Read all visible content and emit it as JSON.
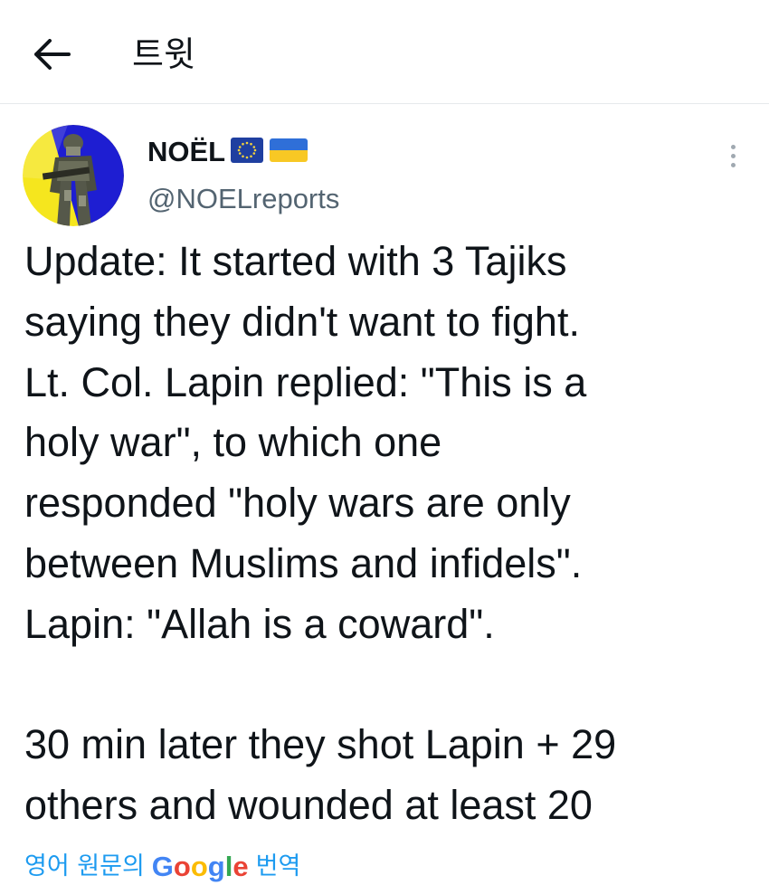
{
  "header": {
    "back_icon": "arrow-left-icon",
    "title": "트윗"
  },
  "author": {
    "display_name": "NOËL",
    "flags": [
      "eu-flag-icon",
      "ukraine-flag-icon"
    ],
    "handle": "@NOELreports",
    "more_icon": "more-vertical-icon"
  },
  "tweet": {
    "text": "Update: It started with 3 Tajiks\nsaying they didn't want to fight.\nLt. Col. Lapin replied: \"This is a\nholy war\", to which one\nresponded \"holy wars are only\nbetween Muslims and infidels\".\nLapin: \"Allah is a coward\".\n\n30 min later they shot Lapin + 29\nothers and wounded at least 20"
  },
  "translate": {
    "prefix": "영어 원문의",
    "google_letters": [
      "G",
      "o",
      "o",
      "g",
      "l",
      "e"
    ],
    "suffix": "번역"
  },
  "colors": {
    "link_blue": "#1d9bf0",
    "secondary_text": "#536471",
    "primary_text": "#0f1419",
    "avatar_blue": "#1e1ed2",
    "avatar_yellow": "#f5e61e"
  }
}
